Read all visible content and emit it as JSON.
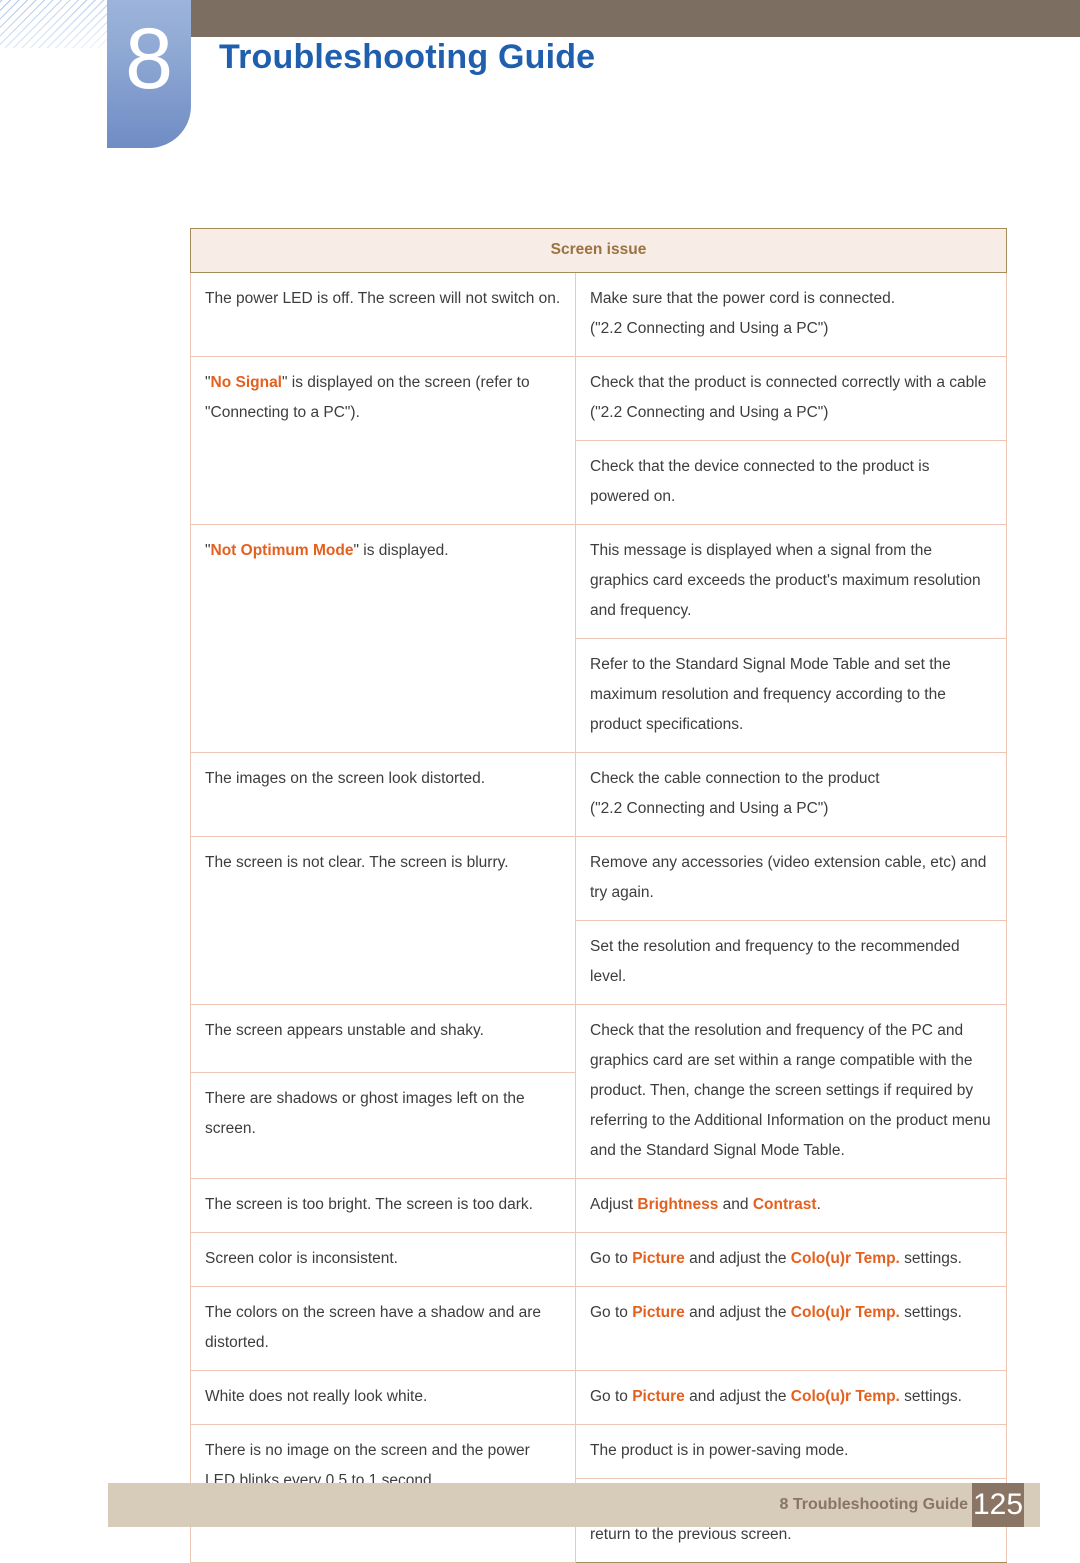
{
  "header": {
    "chapter_number": "8",
    "chapter_title": "Troubleshooting Guide",
    "accent_blue": "#1f5fae",
    "tab_blue": "#8fa9d4",
    "bar_brown": "#7c6f62"
  },
  "table": {
    "header_label": "Screen issue",
    "header_text_color": "#9a7340",
    "header_bg": "#f8ece6",
    "border_color": "#a58a5c",
    "inner_border_color": "#edc7b4",
    "highlight_color": "#e4601f",
    "rows": [
      {
        "issue_prefix": "",
        "issue_highlight": "",
        "issue_suffix": "The power LED is off. The screen will not switch on.",
        "solutions": [
          {
            "lines": [
              "Make sure that the power cord is connected.",
              "(\"2.2 Connecting and Using a PC\")"
            ]
          }
        ]
      },
      {
        "issue_prefix": "\"",
        "issue_highlight": "No Signal",
        "issue_suffix": "\" is displayed on the screen (refer to \"Connecting to a PC\").",
        "solutions": [
          {
            "lines": [
              "Check that the product is connected correctly with a cable",
              "(\"2.2 Connecting and Using a PC\")"
            ]
          },
          {
            "lines": [
              "Check that the device connected to the product is powered on."
            ]
          }
        ]
      },
      {
        "issue_prefix": "\"",
        "issue_highlight": "Not Optimum Mode",
        "issue_suffix": "\" is displayed.",
        "solutions": [
          {
            "lines": [
              "This message is displayed when a signal from the graphics card exceeds the product's maximum resolution and frequency."
            ]
          },
          {
            "lines": [
              "Refer to the Standard Signal Mode Table and set the maximum resolution and frequency according to the product specifications."
            ]
          }
        ]
      },
      {
        "issue_prefix": "",
        "issue_highlight": "",
        "issue_suffix": "The images on the screen look distorted.",
        "solutions": [
          {
            "lines": [
              "Check the cable connection to the product",
              "(\"2.2 Connecting and Using a PC\")"
            ]
          }
        ]
      },
      {
        "issue_prefix": "",
        "issue_highlight": "",
        "issue_suffix": "The screen is not clear. The screen is blurry.",
        "solutions": [
          {
            "lines": [
              "Remove any accessories (video extension cable, etc) and try again."
            ]
          },
          {
            "lines": [
              "Set the resolution and frequency to the recommended level."
            ]
          }
        ]
      }
    ],
    "merged_group": {
      "issues": [
        "The screen appears unstable and shaky.",
        "There are shadows or ghost images left on the screen."
      ],
      "solution": "Check that the resolution and frequency of the PC and graphics card are set within a range compatible with the product. Then, change the screen settings if required by referring to the Additional Information on the product menu and the Standard Signal Mode Table."
    },
    "brightness_row": {
      "issue": "The screen is too bright. The screen is too dark.",
      "sol_part1": "Adjust ",
      "sol_hl1": "Brightness",
      "sol_part2": " and ",
      "sol_hl2": "Contrast",
      "sol_part3": "."
    },
    "color_rows": [
      {
        "issue": "Screen color is inconsistent.",
        "sol_part1": "Go to ",
        "sol_hl1": "Picture",
        "sol_part2": " and adjust the ",
        "sol_hl2": "Colo(u)r Temp.",
        "sol_part3": " settings."
      },
      {
        "issue": "The colors on the screen have a shadow and are distorted.",
        "sol_part1": "Go to ",
        "sol_hl1": "Picture",
        "sol_part2": " and adjust the ",
        "sol_hl2": "Colo(u)r Temp.",
        "sol_part3": " settings."
      },
      {
        "issue": "White does not really look white.",
        "sol_part1": "Go to ",
        "sol_hl1": "Picture",
        "sol_part2": " and adjust the ",
        "sol_hl2": "Colo(u)r Temp.",
        "sol_part3": " settings."
      }
    ],
    "power_row": {
      "issue": "There is no image on the screen and the power LED blinks every 0.5 to 1 second.",
      "solutions": [
        "The product is in power-saving mode.",
        "Press any key on the keyboard or move the mouse to return to the previous screen."
      ]
    }
  },
  "footer": {
    "text": "8 Troubleshooting Guide",
    "page_number": "125",
    "bar_color": "#d7cbba",
    "page_box_color": "#8a7564"
  }
}
